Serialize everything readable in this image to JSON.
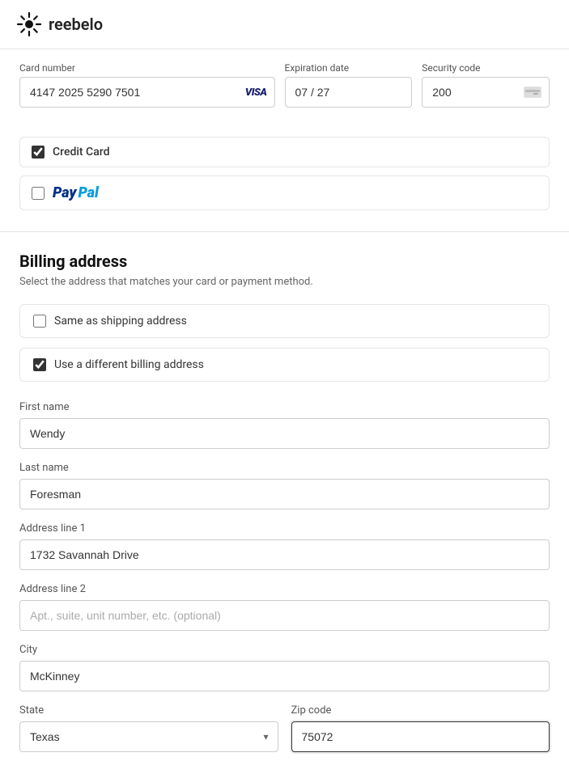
{
  "header": {
    "logo_text": "reebelo"
  },
  "card_section": {
    "card_number_label": "Card number",
    "card_number_value": "4147 2025 5290 7501",
    "card_brand": "VISA",
    "expiry_label": "Expiration date",
    "expiry_value": "07 / 27",
    "security_label": "Security code",
    "security_value": "200"
  },
  "payment_methods": {
    "credit_card": {
      "label": "Credit Card",
      "checked": true
    },
    "paypal": {
      "label": "PayPal",
      "checked": false
    }
  },
  "billing": {
    "title": "Billing address",
    "subtitle": "Select the address that matches your card or payment method.",
    "same_as_shipping_label": "Same as shipping address",
    "same_as_shipping_checked": false,
    "different_billing_label": "Use a different billing address",
    "different_billing_checked": true
  },
  "form": {
    "first_name_label": "First name",
    "first_name_value": "Wendy",
    "last_name_label": "Last name",
    "last_name_value": "Foresman",
    "address1_label": "Address line 1",
    "address1_value": "1732 Savannah Drive",
    "address2_label": "Address line 2",
    "address2_placeholder": "Apt., suite, unit number, etc. (optional)",
    "city_label": "City",
    "city_value": "McKinney",
    "state_label": "State",
    "state_value": "Texas",
    "zip_label": "Zip code",
    "zip_value": "75072"
  }
}
